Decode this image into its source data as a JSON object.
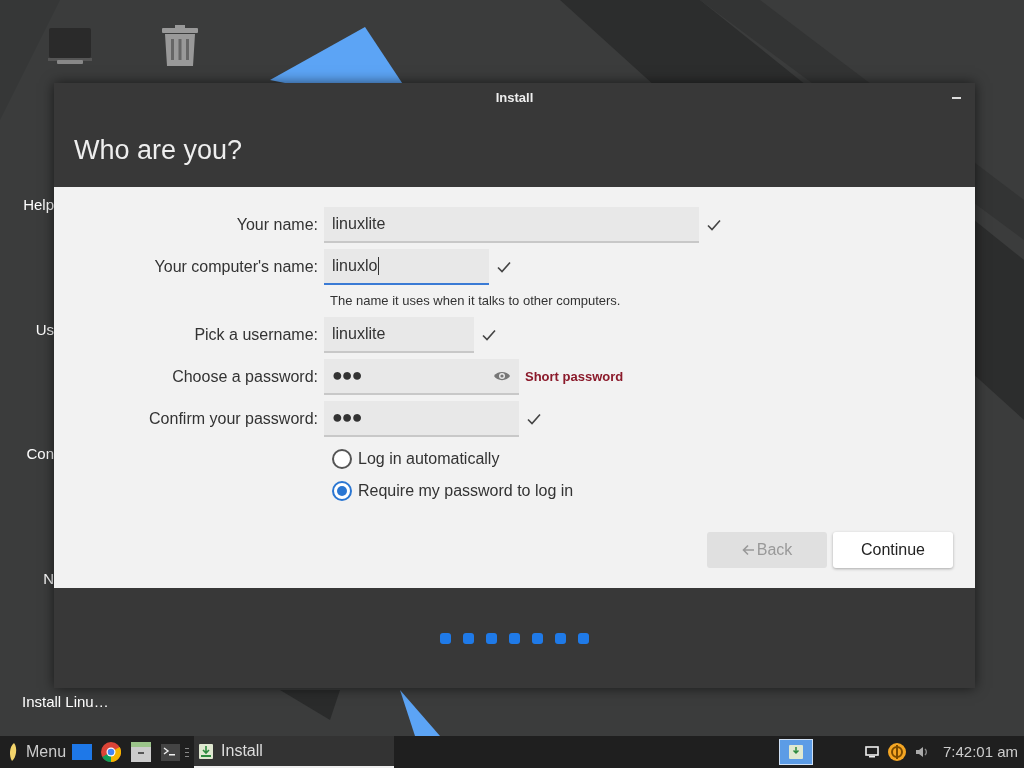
{
  "desktop": {
    "icons": [
      {
        "label": "Help"
      },
      {
        "label": "Us"
      },
      {
        "label": "Con"
      },
      {
        "label": "N"
      },
      {
        "label": "Install Linu…"
      }
    ]
  },
  "window": {
    "title": "Install",
    "heading": "Who are you?"
  },
  "form": {
    "fields": [
      {
        "label": "Your name:",
        "value": "linuxlite",
        "kind": "text",
        "focused": false,
        "valid": true
      },
      {
        "label": "Your computer's name:",
        "value": "linuxlo",
        "kind": "text",
        "focused": true,
        "valid": true,
        "hint": "The name it uses when it talks to other computers."
      },
      {
        "label": "Pick a username:",
        "value": "linuxlite",
        "kind": "text",
        "focused": false,
        "valid": true
      },
      {
        "label": "Choose a password:",
        "value": "●●●",
        "kind": "password",
        "focused": false,
        "valid": false,
        "error_text": "Short password",
        "reveal_toggle": true
      },
      {
        "label": "Confirm your password:",
        "value": "●●●",
        "kind": "password",
        "focused": false,
        "valid": true,
        "reveal_toggle": false
      }
    ],
    "login_options": [
      {
        "label": "Log in automatically",
        "selected": false
      },
      {
        "label": "Require my password to log in",
        "selected": true
      }
    ],
    "buttons": [
      {
        "label": "Back",
        "kind": "back",
        "disabled": true
      },
      {
        "label": "Continue",
        "kind": "continue",
        "disabled": false
      }
    ]
  },
  "progress_dots": [
    {
      "active": true
    },
    {
      "active": true
    },
    {
      "active": true
    },
    {
      "active": true
    },
    {
      "active": true
    },
    {
      "active": true
    },
    {
      "active": true
    }
  ],
  "taskbar": {
    "menu_label": "Menu",
    "tasks": [
      {
        "label": "Install",
        "selected": true
      }
    ],
    "clock": "7:42:01 am"
  }
}
